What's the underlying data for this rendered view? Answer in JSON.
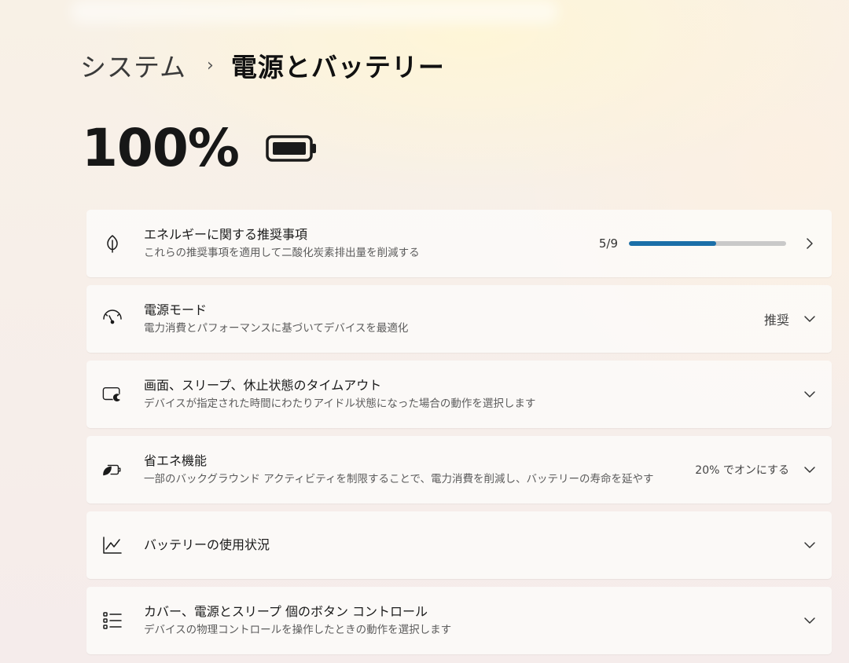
{
  "breadcrumb": {
    "parent": "システム",
    "separator": "›",
    "current": "電源とバッテリー"
  },
  "battery": {
    "percent_label": "100%",
    "level": 1.0,
    "icon": "battery-full-icon"
  },
  "settings": [
    {
      "icon": "leaf-icon",
      "title": "エネルギーに関する推奨事項",
      "subtitle": "これらの推奨事項を適用して二酸化炭素排出量を削減する",
      "progress_label": "5/9",
      "progress": 0.556,
      "control": "chevron-right-icon"
    },
    {
      "icon": "power-mode-gauge-icon",
      "title": "電源モード",
      "subtitle": "電力消費とパフォーマンスに基づいてデバイスを最適化",
      "value": "推奨",
      "control": "chevron-down-icon"
    },
    {
      "icon": "screen-sleep-icon",
      "title": "画面、スリープ、休止状態のタイムアウト",
      "subtitle": "デバイスが指定された時間にわたりアイドル状態になった場合の動作を選択します",
      "control": "chevron-down-icon"
    },
    {
      "icon": "battery-saver-icon",
      "title": "省エネ機能",
      "subtitle": "一部のバックグラウンド アクティビティを制限することで、電力消費を削減し、バッテリーの寿命を延やす",
      "value": "20% でオンにする",
      "control": "chevron-down-icon"
    },
    {
      "icon": "usage-chart-icon",
      "title": "バッテリーの使用状況",
      "control": "chevron-down-icon"
    },
    {
      "icon": "button-list-icon",
      "title": "カバー、電源とスリープ 個のボタン コントロール",
      "subtitle": "デバイスの物理コントロールを操作したときの動作を選択します",
      "control": "chevron-down-icon"
    }
  ],
  "colors": {
    "accent": "#1b6fa8",
    "progress_track": "#c9c9c9"
  }
}
